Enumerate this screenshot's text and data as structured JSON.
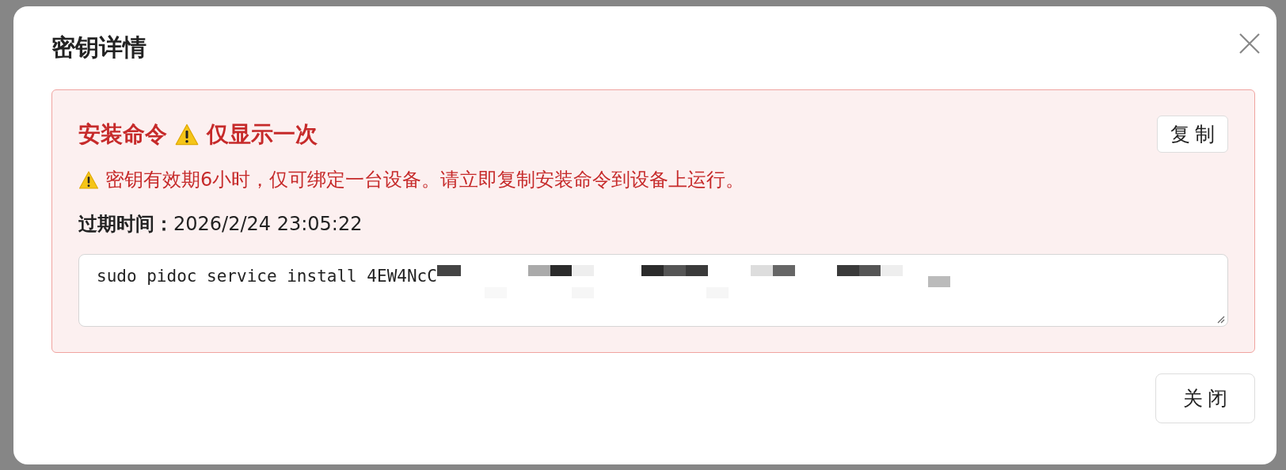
{
  "dialog": {
    "title": "密钥详情",
    "alert": {
      "title": "安装命令",
      "title_note": "仅显示一次",
      "copy_button": "复制",
      "warning": "密钥有效期6小时，仅可绑定一台设备。请立即复制安装命令到设备上运行。",
      "expiry_label": "过期时间：",
      "expiry_value": "2026/2/24 23:05:22",
      "command": "sudo pidoc service install 4EW4NcC"
    },
    "close_button": "关闭"
  }
}
